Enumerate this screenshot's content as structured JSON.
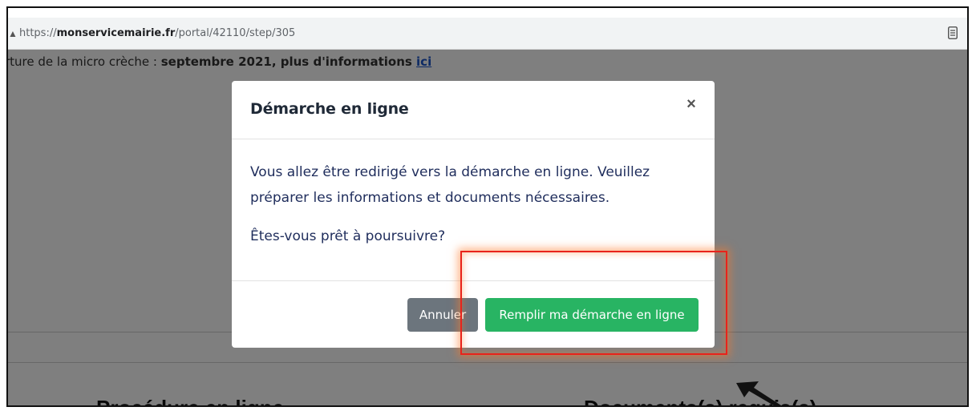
{
  "browser": {
    "url_prefix": "https://",
    "url_host": "monservicemairie.fr",
    "url_path": "/portal/42110/step/305",
    "reader_icon": "reader-mode-icon"
  },
  "page": {
    "notice_start": "rture de la micro crèche : ",
    "notice_bold": "septembre 2021, plus d'informations ",
    "notice_link": "ici",
    "heading_left": "Procédure en ligne",
    "heading_right": "Documents(s) requis(s)"
  },
  "modal": {
    "title": "Démarche en ligne",
    "close_label": "×",
    "body_line1": "Vous allez être redirigé vers la démarche en ligne. Veuillez préparer les informations et documents nécessaires.",
    "body_line2": "Êtes-vous prêt à poursuivre?",
    "cancel_label": "Annuler",
    "confirm_label": "Remplir ma démarche en ligne"
  },
  "colors": {
    "confirm_button": "#28b463",
    "cancel_button": "#6c757d",
    "highlight_border": "#e8231b",
    "overlay": "rgba(0,0,0,0.5)"
  }
}
